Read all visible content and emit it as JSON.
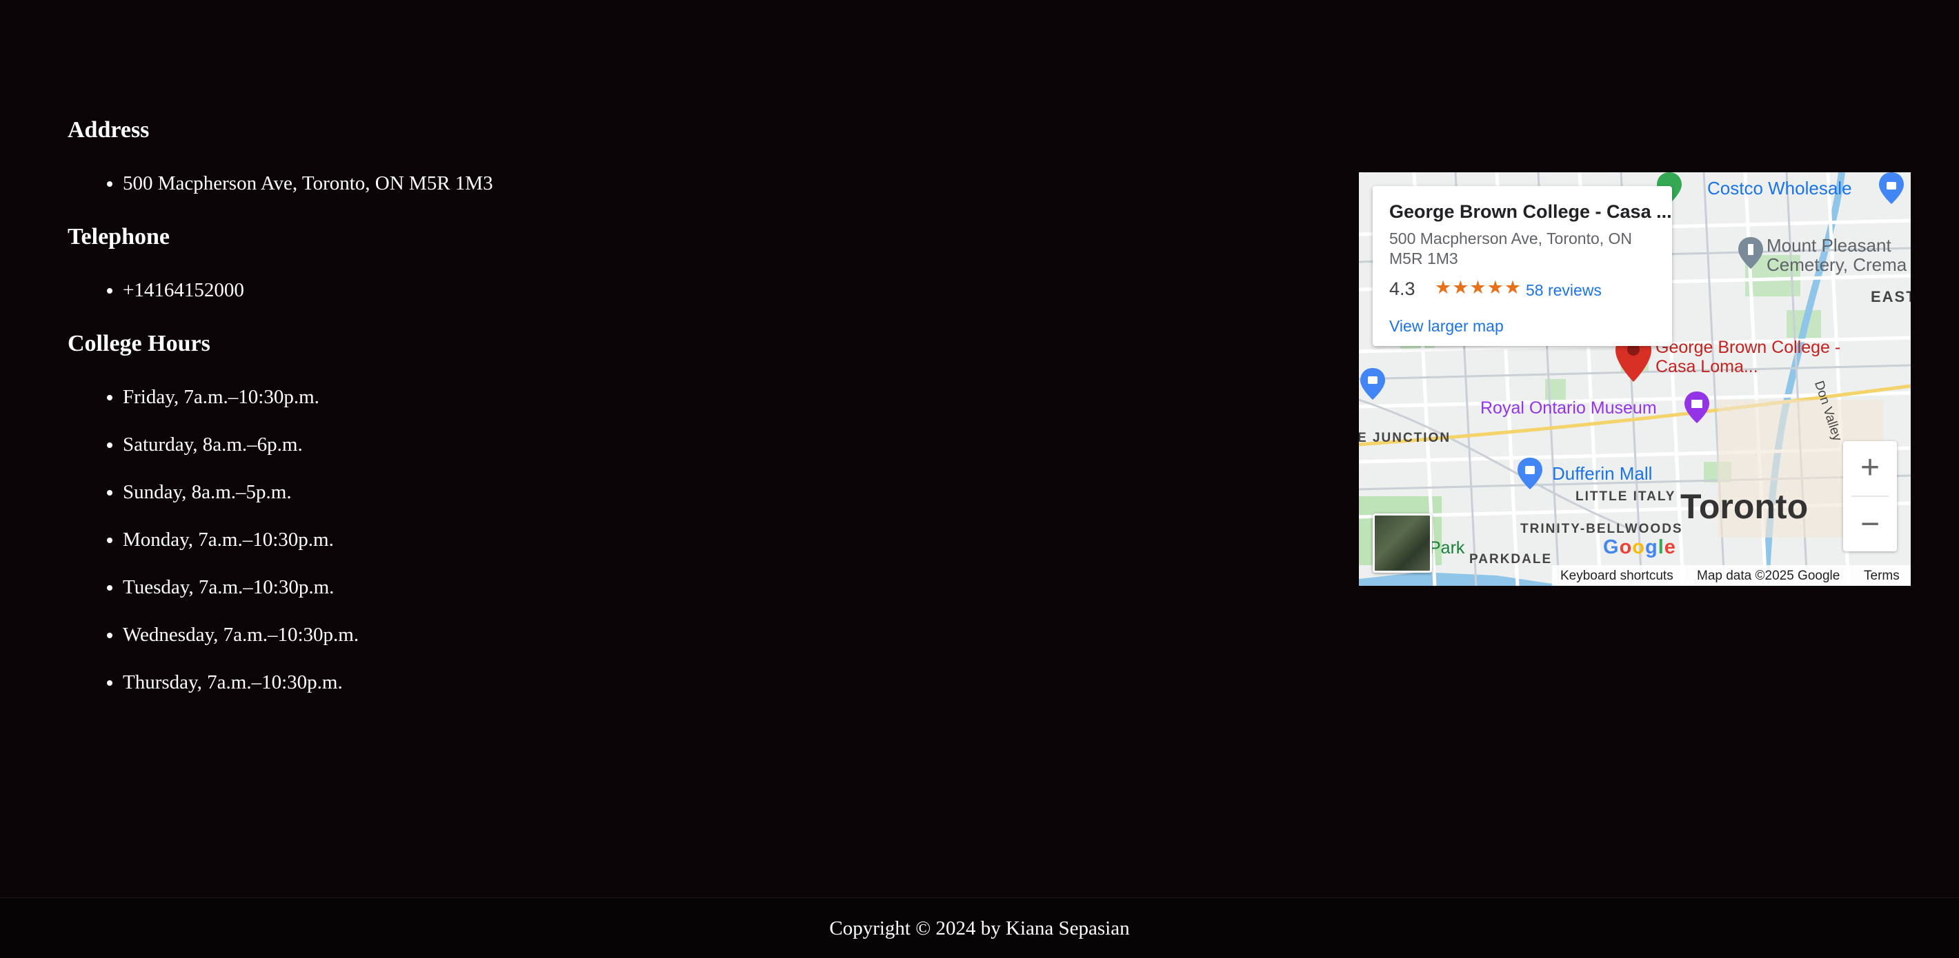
{
  "address": {
    "heading": "Address",
    "items": [
      "500 Macpherson Ave, Toronto, ON M5R 1M3"
    ]
  },
  "telephone": {
    "heading": "Telephone",
    "items": [
      "+14164152000"
    ]
  },
  "hours": {
    "heading": "College Hours",
    "items": [
      "Friday, 7a.m.–10:30p.m.",
      "Saturday, 8a.m.–6p.m.",
      "Sunday, 8a.m.–5p.m.",
      "Monday, 7a.m.–10:30p.m.",
      "Tuesday, 7a.m.–10:30p.m.",
      "Wednesday, 7a.m.–10:30p.m.",
      "Thursday, 7a.m.–10:30p.m."
    ]
  },
  "map": {
    "card": {
      "title": "George Brown College - Casa ...",
      "address": "500 Macpherson Ave, Toronto, ON M5R 1M3",
      "rating": "4.3",
      "stars": "★★★★★",
      "reviews": "58 reviews",
      "larger_map": "View larger map"
    },
    "labels": {
      "costco": "Costco Wholesale",
      "mount_pleasant": "Mount Pleasant Cemetery, Crema",
      "east": "EAST",
      "gbc_pin": "George Brown College - Casa Loma...",
      "rom": "Royal Ontario Museum",
      "junction": "E JUNCTION",
      "dufferin": "Dufferin Mall",
      "little_italy": "LITTLE ITALY",
      "toronto": "Toronto",
      "trinity": "TRINITY-BELLWOODS",
      "parkdale": "PARKDALE",
      "park": "Park",
      "don_valley": "Don Valley"
    },
    "zoom_in": "+",
    "zoom_out": "−",
    "attribution": {
      "shortcuts": "Keyboard shortcuts",
      "data": "Map data ©2025 Google",
      "terms": "Terms"
    },
    "logo": "Google",
    "colors": {
      "pin": "#d93025",
      "water": "#8ec5e8",
      "park": "#b8e0b0",
      "link": "#1a73e8",
      "poi_purple": "#9334e6"
    }
  },
  "footer": {
    "copyright": "Copyright © 2024 by Kiana Sepasian"
  }
}
